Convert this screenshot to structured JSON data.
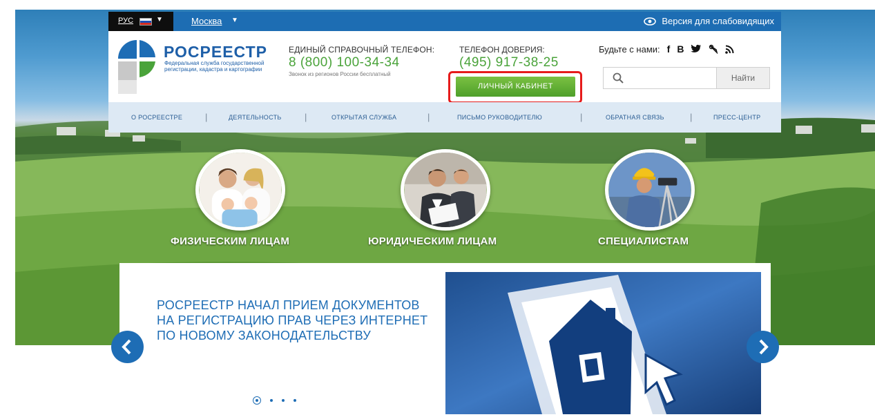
{
  "topbar": {
    "lang": "РУС",
    "city": "Москва",
    "vision": "Версия для слабовидящих"
  },
  "logo": {
    "title": "РОСРЕЕСТР",
    "subtitle": "Федеральная служба государственной регистрации, кадастра и картографии"
  },
  "phone": {
    "label": "ЕДИНЫЙ СПРАВОЧНЫЙ ТЕЛЕФОН:",
    "number": "8 (800) 100-34-34",
    "note": "Звонок из регионов России бесплатный"
  },
  "trust": {
    "label": "ТЕЛЕФОН ДОВЕРИЯ:",
    "number": "(495) 917-38-25"
  },
  "cabinet": {
    "label": "ЛИЧНЫЙ КАБИНЕТ"
  },
  "social": {
    "label": "Будьте с нами:",
    "icons": [
      "f",
      "B",
      "✓",
      "✎",
      "⁾"
    ]
  },
  "search": {
    "placeholder": "",
    "button": "Найти"
  },
  "nav": [
    "О РОСРЕЕСТРЕ",
    "ДЕЯТЕЛЬНОСТЬ",
    "ОТКРЫТАЯ СЛУЖБА",
    "ПИСЬМО РУКОВОДИТЕЛЮ",
    "ОБРАТНАЯ СВЯЗЬ",
    "ПРЕСС-ЦЕНТР"
  ],
  "categories": [
    "ФИЗИЧЕСКИМ ЛИЦАМ",
    "ЮРИДИЧЕСКИМ ЛИЦАМ",
    "СПЕЦИАЛИСТАМ"
  ],
  "slider": {
    "headline": "РОСРЕЕСТР НАЧАЛ ПРИЕМ ДОКУМЕНТОВ НА РЕГИСТРАЦИЮ ПРАВ ЧЕРЕЗ ИНТЕРНЕТ ПО НОВОМУ ЗАКОНОДАТЕЛЬСТВУ",
    "slide_count": 4,
    "active_slide": 1
  },
  "colors": {
    "brand_blue": "#1e6db5",
    "accent_green": "#4aa33a",
    "highlight_red": "#e61b1b"
  }
}
